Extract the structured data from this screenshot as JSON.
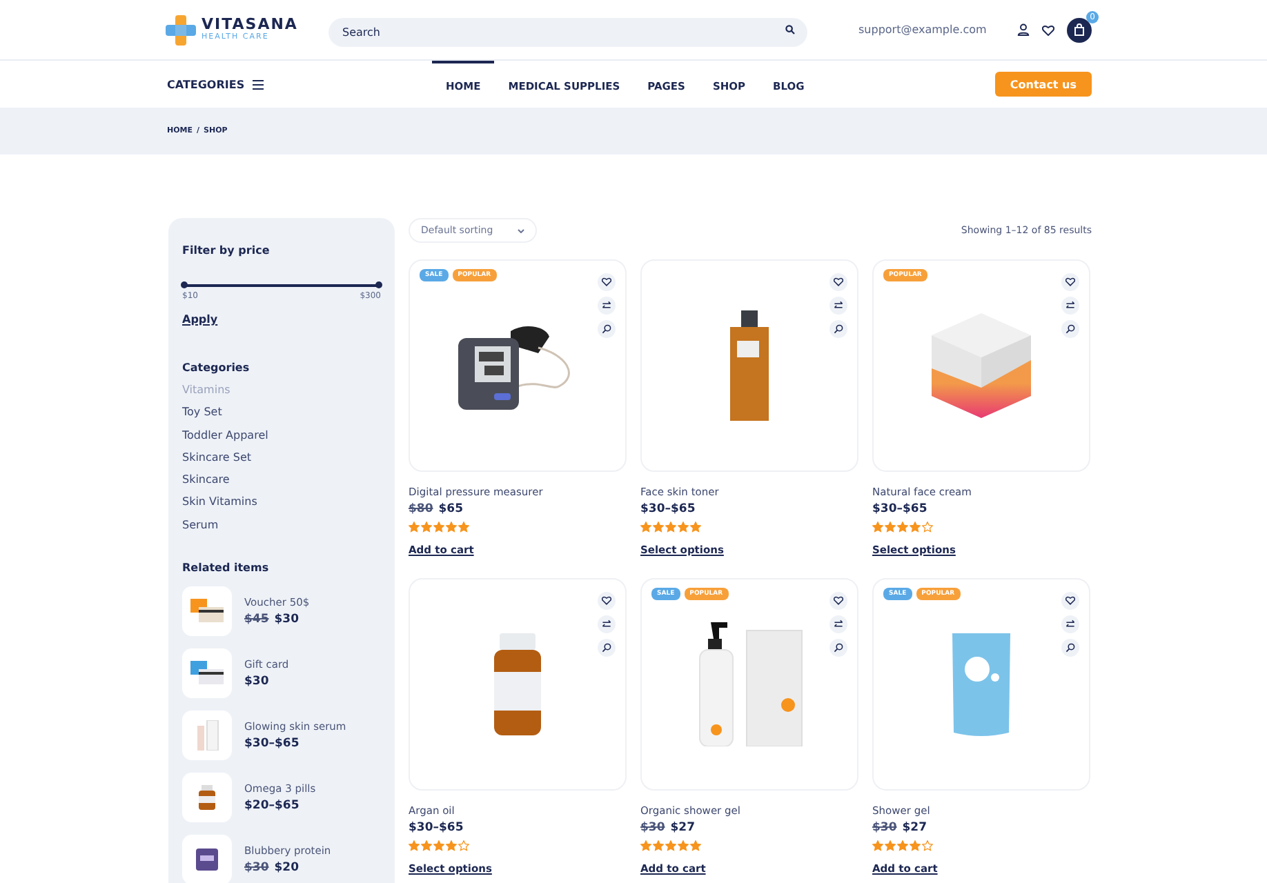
{
  "header": {
    "logo": {
      "name": "VITASANA",
      "tagline": "HEALTH CARE"
    },
    "search": {
      "placeholder": "Search"
    },
    "email": "support@example.com",
    "cart_count": "0"
  },
  "nav": {
    "categories": "CATEGORIES",
    "items": [
      {
        "label": "HOME",
        "selected": true
      },
      {
        "label": "MEDICAL SUPPLIES",
        "selected": false
      },
      {
        "label": "PAGES",
        "selected": false
      },
      {
        "label": "SHOP",
        "selected": false
      },
      {
        "label": "BLOG",
        "selected": false
      }
    ],
    "contact": "Contact us"
  },
  "breadcrumb": {
    "items": [
      "HOME",
      "SHOP"
    ],
    "separator": "/"
  },
  "sidebar": {
    "price_filter": {
      "title": "Filter by price",
      "level": 1,
      "min": "$10",
      "max": "$300",
      "apply": "Apply"
    },
    "categories": {
      "title": "Categories",
      "items": [
        {
          "label": "Vitamins",
          "selected": true
        },
        {
          "label": "Toy Set",
          "selected": false
        },
        {
          "label": "Toddler Apparel",
          "selected": false
        },
        {
          "label": "Skincare Set",
          "selected": false
        },
        {
          "label": "Skincare",
          "selected": false
        },
        {
          "label": "Skin Vitamins",
          "selected": false
        },
        {
          "label": "Serum",
          "selected": false
        }
      ]
    },
    "related": {
      "title": "Related items",
      "items": [
        {
          "name": "Voucher 50$",
          "old_price": "$45",
          "price": "$30",
          "kind": "voucher"
        },
        {
          "name": "Gift card",
          "price": "$30",
          "kind": "giftcard"
        },
        {
          "name": "Glowing skin serum",
          "price": "$30–$65",
          "kind": "serum"
        },
        {
          "name": "Omega 3 pills",
          "price": "$20–$65",
          "kind": "pills"
        },
        {
          "name": "Blubbery protein",
          "old_price": "$30",
          "price": "$20",
          "kind": "protein"
        }
      ]
    }
  },
  "shop": {
    "sorting": "Default sorting",
    "result_count": "Showing 1–12 of 85 results",
    "products": [
      {
        "name": "Digital pressure measurer",
        "old_price": "$80",
        "price": "$65",
        "stars": 5,
        "action": "Add to cart",
        "kind": "monitor",
        "badges": [
          {
            "label": "SALE",
            "kind": "sale"
          },
          {
            "label": "POPULAR",
            "kind": "popular"
          }
        ]
      },
      {
        "name": "Face skin toner",
        "price": "$30–$65",
        "stars": 5,
        "action": "Select options",
        "kind": "bottle"
      },
      {
        "name": "Natural face cream",
        "price": "$30–$65",
        "stars": 4,
        "action": "Select options",
        "kind": "box",
        "badges": [
          {
            "label": "POPULAR",
            "kind": "popular"
          }
        ]
      },
      {
        "name": "Argan oil",
        "price": "$30–$65",
        "stars": 4,
        "action": "Select options",
        "kind": "jar"
      },
      {
        "name": "Organic shower gel",
        "old_price": "$30",
        "price": "$27",
        "stars": 5,
        "action": "Add to cart",
        "kind": "gel",
        "badges": [
          {
            "label": "SALE",
            "kind": "sale"
          },
          {
            "label": "POPULAR",
            "kind": "popular"
          }
        ]
      },
      {
        "name": "Shower gel",
        "old_price": "$30",
        "price": "$27",
        "stars": 4,
        "action": "Add to cart",
        "kind": "pouch",
        "badges": [
          {
            "label": "SALE",
            "kind": "sale"
          },
          {
            "label": "POPULAR",
            "kind": "popular"
          }
        ]
      }
    ]
  }
}
